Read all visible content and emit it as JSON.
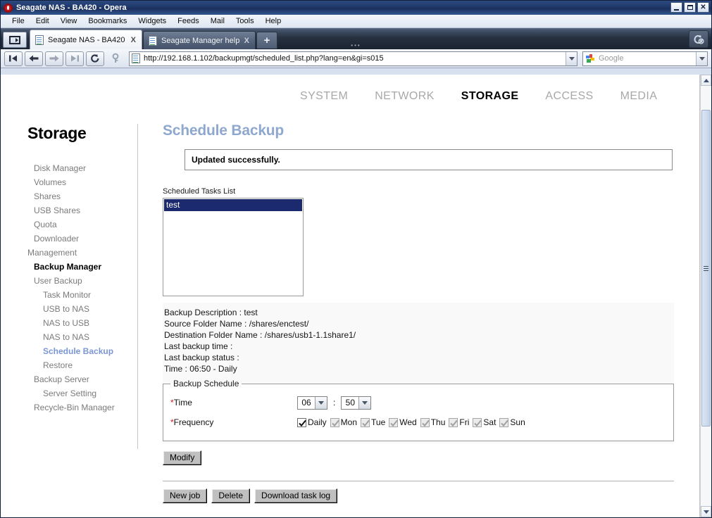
{
  "window": {
    "title": "Seagate NAS - BA420 - Opera",
    "minimize_label": "Minimize",
    "maximize_label": "Maximize",
    "close_label": "Close"
  },
  "menubar": {
    "items": [
      "File",
      "Edit",
      "View",
      "Bookmarks",
      "Widgets",
      "Feeds",
      "Mail",
      "Tools",
      "Help"
    ]
  },
  "tabs": {
    "items": [
      {
        "title": "Seagate NAS - BA420",
        "close_label": "X",
        "active": true
      },
      {
        "title": "Seagate Manager help",
        "close_label": "X",
        "active": false
      }
    ],
    "new_tab_label": "+"
  },
  "toolbar": {
    "buttons": [
      "first-page",
      "back",
      "forward",
      "last-page",
      "reload",
      "wand"
    ]
  },
  "address": {
    "url": "http://192.168.1.102/backupmgt/scheduled_list.php?lang=en&gi=s015"
  },
  "search": {
    "placeholder": "Google",
    "value": "Google"
  },
  "topnav": {
    "items": [
      {
        "label": "SYSTEM",
        "active": false
      },
      {
        "label": "NETWORK",
        "active": false
      },
      {
        "label": "STORAGE",
        "active": true
      },
      {
        "label": "ACCESS",
        "active": false
      },
      {
        "label": "MEDIA",
        "active": false
      }
    ]
  },
  "sidebar": {
    "title": "Storage",
    "items": [
      {
        "label": "Disk Manager",
        "level": 1,
        "state": "normal"
      },
      {
        "label": "Volumes",
        "level": 1,
        "state": "normal"
      },
      {
        "label": "Shares",
        "level": 1,
        "state": "normal"
      },
      {
        "label": "USB Shares",
        "level": 1,
        "state": "normal"
      },
      {
        "label": "Quota",
        "level": 1,
        "state": "normal"
      },
      {
        "label": "Downloader",
        "level": 1,
        "state": "normal"
      },
      {
        "label": "Management",
        "level": 0,
        "state": "normal"
      },
      {
        "label": "Backup Manager",
        "level": 1,
        "state": "bold"
      },
      {
        "label": "User Backup",
        "level": 1,
        "state": "normal"
      },
      {
        "label": "Task Monitor",
        "level": 2,
        "state": "normal"
      },
      {
        "label": "USB to NAS",
        "level": 2,
        "state": "normal"
      },
      {
        "label": "NAS to USB",
        "level": 2,
        "state": "normal"
      },
      {
        "label": "NAS to NAS",
        "level": 2,
        "state": "normal"
      },
      {
        "label": "Schedule Backup",
        "level": 2,
        "state": "selected"
      },
      {
        "label": "Restore",
        "level": 2,
        "state": "normal"
      },
      {
        "label": "Backup Server",
        "level": 1,
        "state": "normal"
      },
      {
        "label": "Server Setting",
        "level": 2,
        "state": "normal"
      },
      {
        "label": "Recycle-Bin Manager",
        "level": 1,
        "state": "normal"
      }
    ]
  },
  "main": {
    "page_title": "Schedule Backup",
    "notice": "Updated successfully.",
    "list_label": "Scheduled Tasks List",
    "task_list": [
      {
        "name": "test",
        "selected": true
      }
    ],
    "details": [
      "Backup Description : test",
      "Source Folder Name : /shares/enctest/",
      "Destination Folder Name : /shares/usb1-1.1share1/",
      "Last backup time :",
      "Last backup status :",
      "Time : 06:50 - Daily"
    ],
    "schedule": {
      "legend": "Backup Schedule",
      "time_label": "Time",
      "frequency_label": "Frequency",
      "required_marker": "*",
      "hour_value": "06",
      "minute_value": "50",
      "time_separator": ":",
      "frequency_options": [
        {
          "label": "Daily",
          "checked": true,
          "disabled": false
        },
        {
          "label": "Mon",
          "checked": true,
          "disabled": true
        },
        {
          "label": "Tue",
          "checked": true,
          "disabled": true
        },
        {
          "label": "Wed",
          "checked": true,
          "disabled": true
        },
        {
          "label": "Thu",
          "checked": true,
          "disabled": true
        },
        {
          "label": "Fri",
          "checked": true,
          "disabled": true
        },
        {
          "label": "Sat",
          "checked": true,
          "disabled": true
        },
        {
          "label": "Sun",
          "checked": true,
          "disabled": true
        }
      ]
    },
    "modify_button": "Modify",
    "bottom_buttons": [
      "New job",
      "Delete",
      "Download task log"
    ]
  },
  "colors": {
    "title_accent": "#8fa8cf",
    "sidebar_selected": "#7b96d4",
    "list_selection_bg": "#1b2a6e",
    "required_marker": "#d02020",
    "titlebar_bg": "#20386a",
    "opera_red": "#c8161d"
  }
}
